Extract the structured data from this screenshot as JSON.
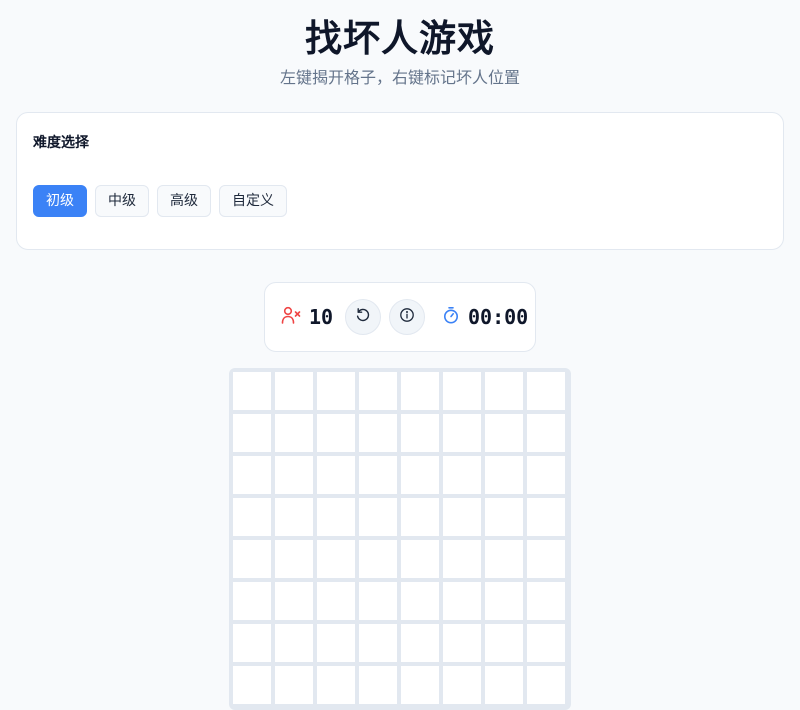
{
  "header": {
    "title": "找坏人游戏",
    "subtitle": "左键揭开格子，右键标记坏人位置"
  },
  "difficulty": {
    "label": "难度选择",
    "options": [
      {
        "label": "初级",
        "active": true
      },
      {
        "label": "中级",
        "active": false
      },
      {
        "label": "高级",
        "active": false
      },
      {
        "label": "自定义",
        "active": false
      }
    ]
  },
  "status": {
    "bad_count": "10",
    "counter_icon": "user-x-icon",
    "reset_icon": "reset-icon",
    "info_icon": "info-icon",
    "timer_icon": "stopwatch-icon",
    "timer": "00:00"
  },
  "board": {
    "rows": 8,
    "cols": 8
  },
  "colors": {
    "accent": "#3b82f6",
    "danger": "#ef4444",
    "board_bg": "#e2e8f0",
    "cell": "#ffffff"
  }
}
